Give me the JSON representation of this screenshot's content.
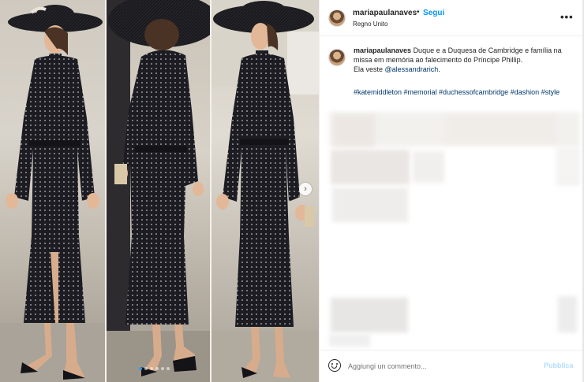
{
  "post": {
    "username": "mariapaulanaves",
    "separator": "•",
    "follow_label": "Segui",
    "location": "Regno Unito",
    "more_label": "•••"
  },
  "caption": {
    "username": "mariapaulanaves",
    "line1": "Duque e a Duquesa de Cambridge e família na",
    "line2": "missa em memória ao falecimento do Príncipe Phillip.",
    "line3_prefix": "Ela veste ",
    "mention": "@alessandrarich",
    "line3_suffix": ".",
    "hashtags": "#katemiddleton #memorial #duchessofcambridge #dashion #style"
  },
  "carousel": {
    "next_glyph": "›",
    "slide_count": 6,
    "active_slide": 1
  },
  "comment_box": {
    "placeholder": "Aggiungi un commento...",
    "publish_label": "Pubblica"
  },
  "colors": {
    "link_blue": "#0095f6",
    "hashtag_blue": "#00376b",
    "publish_disabled": "#b2dffc",
    "dress": "#1c1c22"
  },
  "icons": {
    "emoji": "smiley-face-icon",
    "next": "chevron-right-icon",
    "more": "ellipsis-icon"
  }
}
